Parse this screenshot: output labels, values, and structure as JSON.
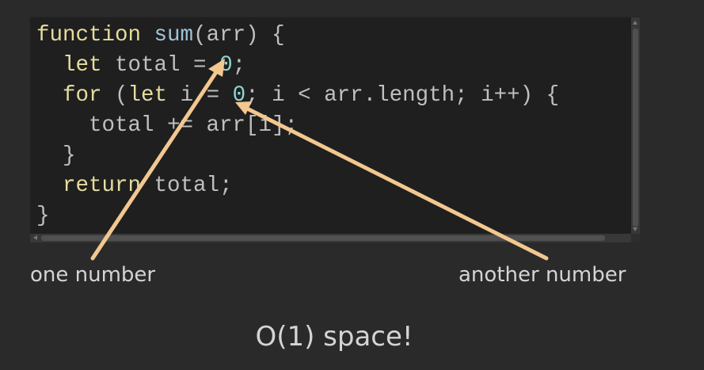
{
  "code": {
    "line1": {
      "kw": "function",
      "sp": " ",
      "fn": "sum",
      "rest": "(arr) {"
    },
    "line2": {
      "indent": "  ",
      "kw": "let",
      "mid": " total = ",
      "num": "0",
      "end": ";"
    },
    "line3": {
      "indent": "  ",
      "kw1": "for",
      "a": " (",
      "kw2": "let",
      "b": " i = ",
      "num": "0",
      "c": "; i < arr.length; i++) {"
    },
    "line4": {
      "text": "    total += arr[i];"
    },
    "line5": {
      "text": "  }"
    },
    "line6": {
      "indent": "  ",
      "kw": "return",
      "rest": " total;"
    },
    "line7": {
      "text": "}"
    }
  },
  "annotations": {
    "one_number": "one number",
    "another_number": "another number"
  },
  "caption": "O(1) space!",
  "colors": {
    "background": "#2a2a2b",
    "editor_bg": "#1f1f1f",
    "keyword": "#e6dc9e",
    "function_name": "#9fc3d9",
    "number": "#8fd6cf",
    "arrow": "#f2c890"
  }
}
